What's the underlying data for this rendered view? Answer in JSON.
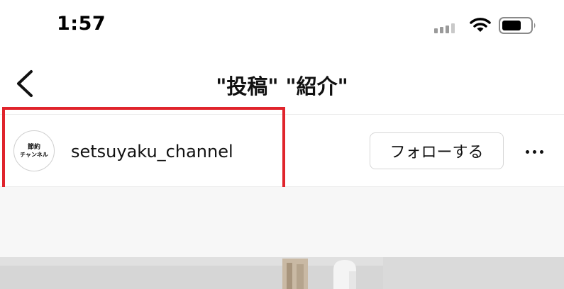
{
  "status_bar": {
    "time": "1:57",
    "icons": [
      "signal-icon",
      "wifi-icon",
      "battery-icon"
    ]
  },
  "nav": {
    "back_icon": "chevron-left-icon",
    "title": "\"投稿\" \"紹介\""
  },
  "post": {
    "avatar_text_line1": "節約",
    "avatar_text_line2": "チャンネル",
    "username": "setsuyaku_channel",
    "follow_label": "フォローする",
    "more_icon": "more-horizontal-icon"
  },
  "colors": {
    "highlight": "#e0242c",
    "border": "#d6d6d6",
    "text": "#111111"
  }
}
